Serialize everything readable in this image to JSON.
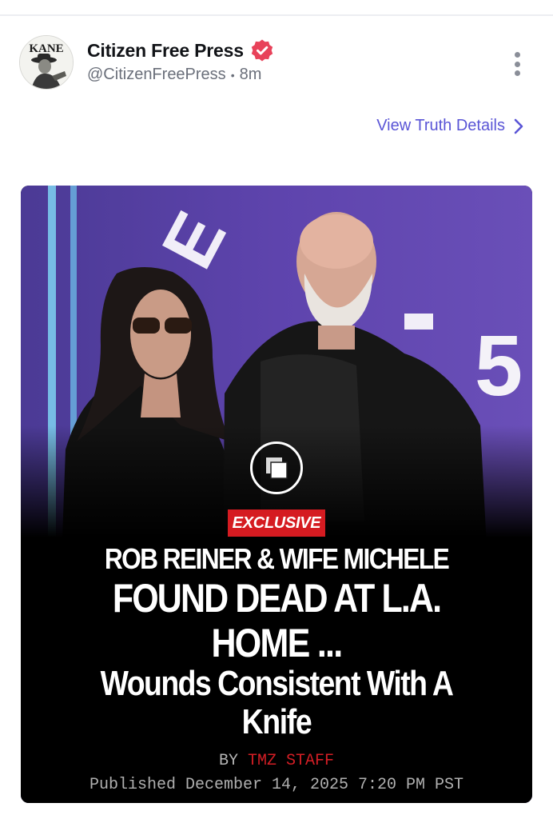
{
  "post": {
    "display_name": "Citizen Free Press",
    "handle": "@CitizenFreePress",
    "separator": "•",
    "time_ago": "8m",
    "avatar_text": "KANE",
    "view_details_label": "View Truth Details"
  },
  "media": {
    "backdrop_letters": [
      "E",
      "H"
    ],
    "backdrop_number": "5",
    "badge": "EXCLUSIVE",
    "headline_lines": [
      "ROB REINER & WIFE MICHELE",
      "FOUND DEAD AT L.A.",
      "HOME ...",
      "Wounds Consistent With A",
      "Knife"
    ],
    "byline_prefix": "BY",
    "byline_author": "TMZ STAFF",
    "published": "Published December 14, 2025 7:20 PM PST"
  },
  "colors": {
    "accent_link": "#5a55d6",
    "verified_badge": "#e8425a",
    "exclusive_red": "#d51b21",
    "backdrop_purple": "#5b3fa6"
  },
  "icons": {
    "verified": "verified-badge-icon",
    "more": "more-vertical-icon",
    "chevron": "chevron-right-icon",
    "gallery": "multiple-images-icon"
  }
}
